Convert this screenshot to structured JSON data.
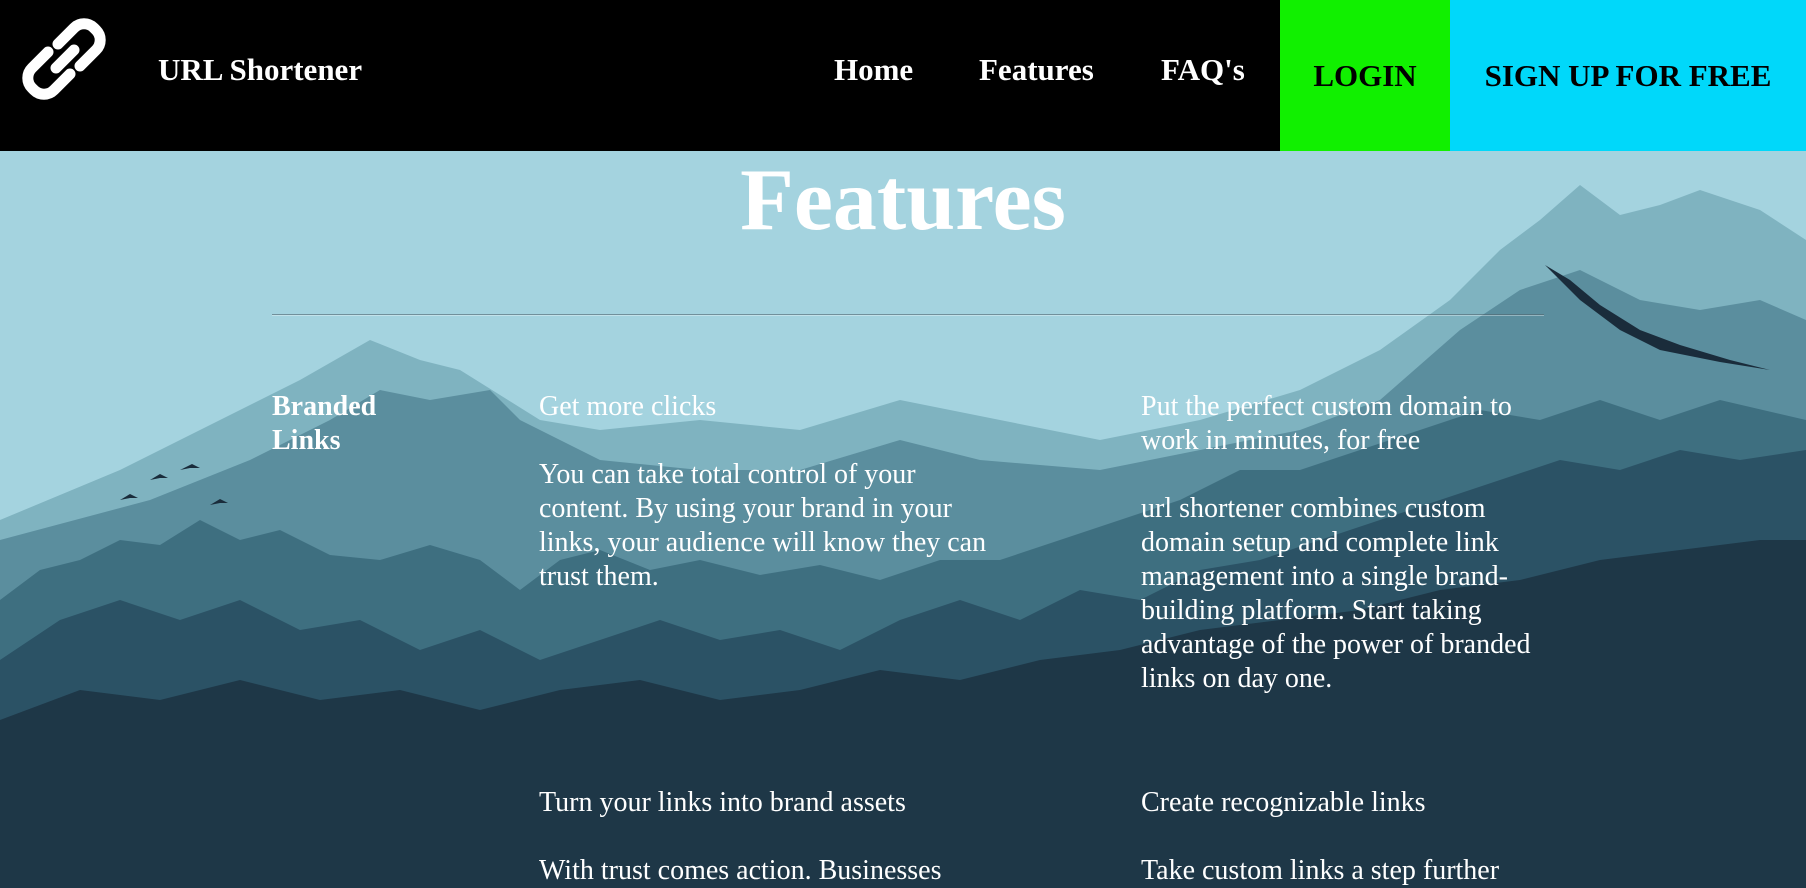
{
  "nav": {
    "brand": "URL Shortener",
    "links": [
      "Home",
      "Features",
      "FAQ's"
    ],
    "login": "LOGIN",
    "signup": "SIGN UP FOR FREE"
  },
  "page": {
    "title": "Features"
  },
  "section": {
    "label": "Branded Links",
    "features": [
      {
        "heading": "Get more clicks",
        "body": "You can take total control of your content. By using your brand in your links, your audience will know they can trust them."
      },
      {
        "heading": "Put the perfect custom domain to work in minutes, for free",
        "body": "url shortener combines custom domain setup and complete link management into a single brand-building platform. Start taking advantage of the power of branded links on day one."
      },
      {
        "heading": "Turn your links into brand assets",
        "body": "With trust comes action. Businesses"
      },
      {
        "heading": "Create recognizable links",
        "body": "Take custom links a step further"
      }
    ]
  },
  "colors": {
    "login_bg": "#11f000",
    "signup_bg": "#00d8fa",
    "nav_bg": "#000000",
    "sky": "#a4d3df"
  },
  "icons": {
    "logo": "link-icon"
  }
}
